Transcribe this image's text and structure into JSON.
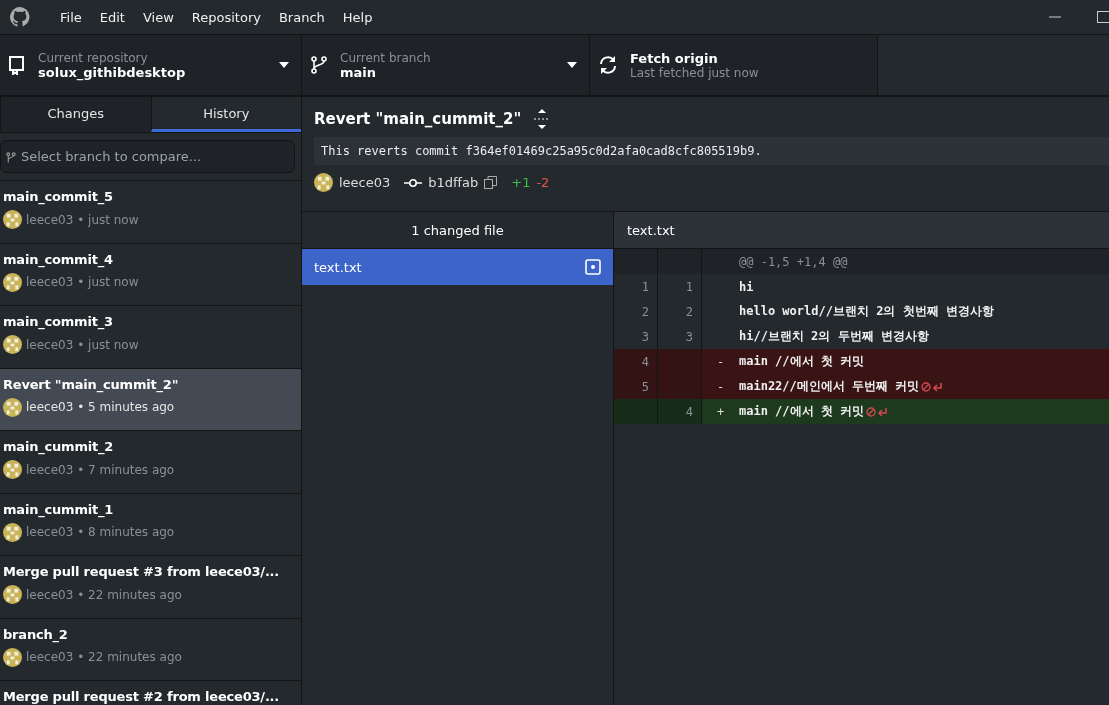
{
  "menu": [
    "File",
    "Edit",
    "View",
    "Repository",
    "Branch",
    "Help"
  ],
  "toolbar": {
    "repository": {
      "label": "Current repository",
      "value": "solux_githibdesktop"
    },
    "branch": {
      "label": "Current branch",
      "value": "main"
    },
    "fetch": {
      "label": "Fetch origin",
      "status": "Last fetched just now"
    }
  },
  "tabs": [
    {
      "label": "Changes",
      "selected": false
    },
    {
      "label": "History",
      "selected": true
    }
  ],
  "branch_filter": {
    "placeholder": "Select branch to compare..."
  },
  "commits": [
    {
      "title": "main_commit_5",
      "meta": "leece03 • just now",
      "selected": false
    },
    {
      "title": "main_commit_4",
      "meta": "leece03 • just now",
      "selected": false
    },
    {
      "title": "main_commit_3",
      "meta": "leece03 • just now",
      "selected": false
    },
    {
      "title": "Revert \"main_cummit_2\"",
      "meta": "leece03 • 5 minutes ago",
      "selected": true
    },
    {
      "title": "main_cummit_2",
      "meta": "leece03 • 7 minutes ago",
      "selected": false
    },
    {
      "title": "main_cummit_1",
      "meta": "leece03 • 8 minutes ago",
      "selected": false
    },
    {
      "title": "Merge pull request #3 from leece03/...",
      "meta": "leece03 • 22 minutes ago",
      "selected": false
    },
    {
      "title": "branch_2",
      "meta": "leece03 • 22 minutes ago",
      "selected": false
    },
    {
      "title": "Merge pull request #2 from leece03/...",
      "selected": false
    }
  ],
  "commit_detail": {
    "title": "Revert \"main_cummit_2\"",
    "message": "This reverts commit f364ef01469c25a95c0d2afa0cad8cfc805519b9.",
    "author": "leece03",
    "sha": "b1dffab",
    "additions": "+1",
    "deletions": "-2"
  },
  "files": {
    "header": "1 changed file",
    "items": [
      {
        "name": "text.txt",
        "selected": true
      }
    ]
  },
  "diff": {
    "file": "text.txt",
    "lines": [
      {
        "kind": "hunk",
        "text": "@@ -1,5 +1,4 @@"
      },
      {
        "kind": "context",
        "old": "1",
        "new": "1",
        "text": "hi"
      },
      {
        "kind": "context",
        "old": "2",
        "new": "2",
        "text": "hello world//브랜치 2의 첫번째 변경사항"
      },
      {
        "kind": "context",
        "old": "3",
        "new": "3",
        "text": "hi//브랜치 2의 두번째 변경사항"
      },
      {
        "kind": "deleted",
        "old": "4",
        "marker": "-",
        "text": "main //에서 첫 커밋"
      },
      {
        "kind": "deleted",
        "old": "5",
        "marker": "-",
        "text": "main22//메인에서 두번째 커밋",
        "no_newline": true
      },
      {
        "kind": "added",
        "new": "4",
        "marker": "+",
        "text": "main //에서 첫 커밋",
        "no_newline": true
      }
    ]
  }
}
